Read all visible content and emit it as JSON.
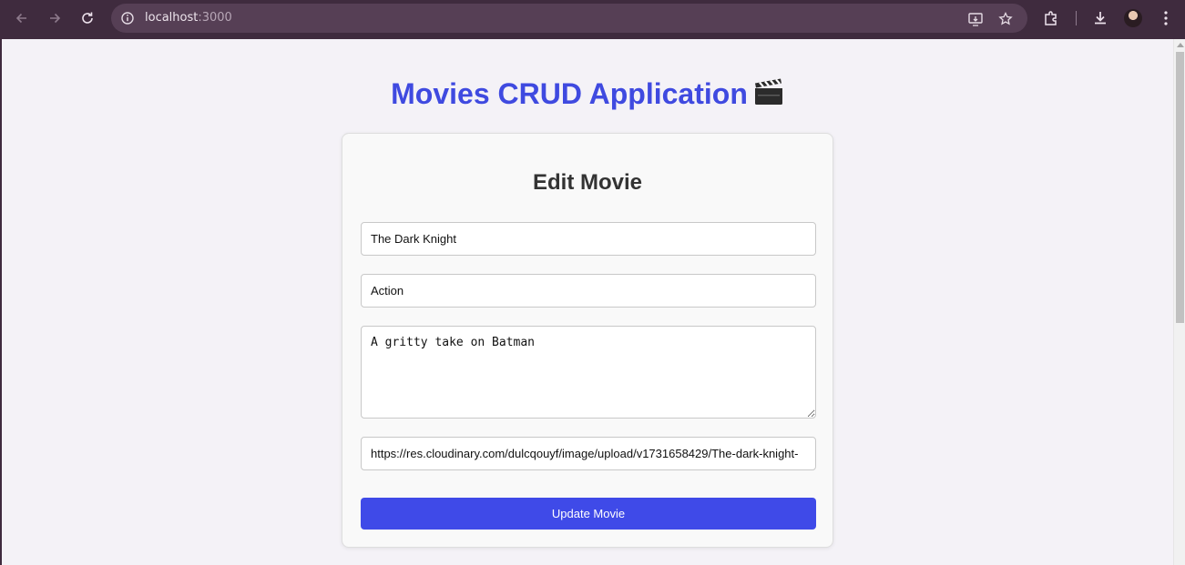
{
  "browser": {
    "url_host": "localhost",
    "url_port": ":3000"
  },
  "app": {
    "title": "Movies CRUD Application",
    "title_emoji": "clapper-board-icon"
  },
  "form": {
    "heading": "Edit Movie",
    "title_value": "The Dark Knight",
    "genre_value": "Action",
    "description_value": "A gritty take on Batman",
    "poster_url_value": "https://res.cloudinary.com/dulcqouyf/image/upload/v1731658429/The-dark-knight-",
    "submit_label": "Update Movie"
  },
  "colors": {
    "accent": "#3f4ae8",
    "title": "#3f4ae0",
    "chrome": "#3f2b3e"
  }
}
